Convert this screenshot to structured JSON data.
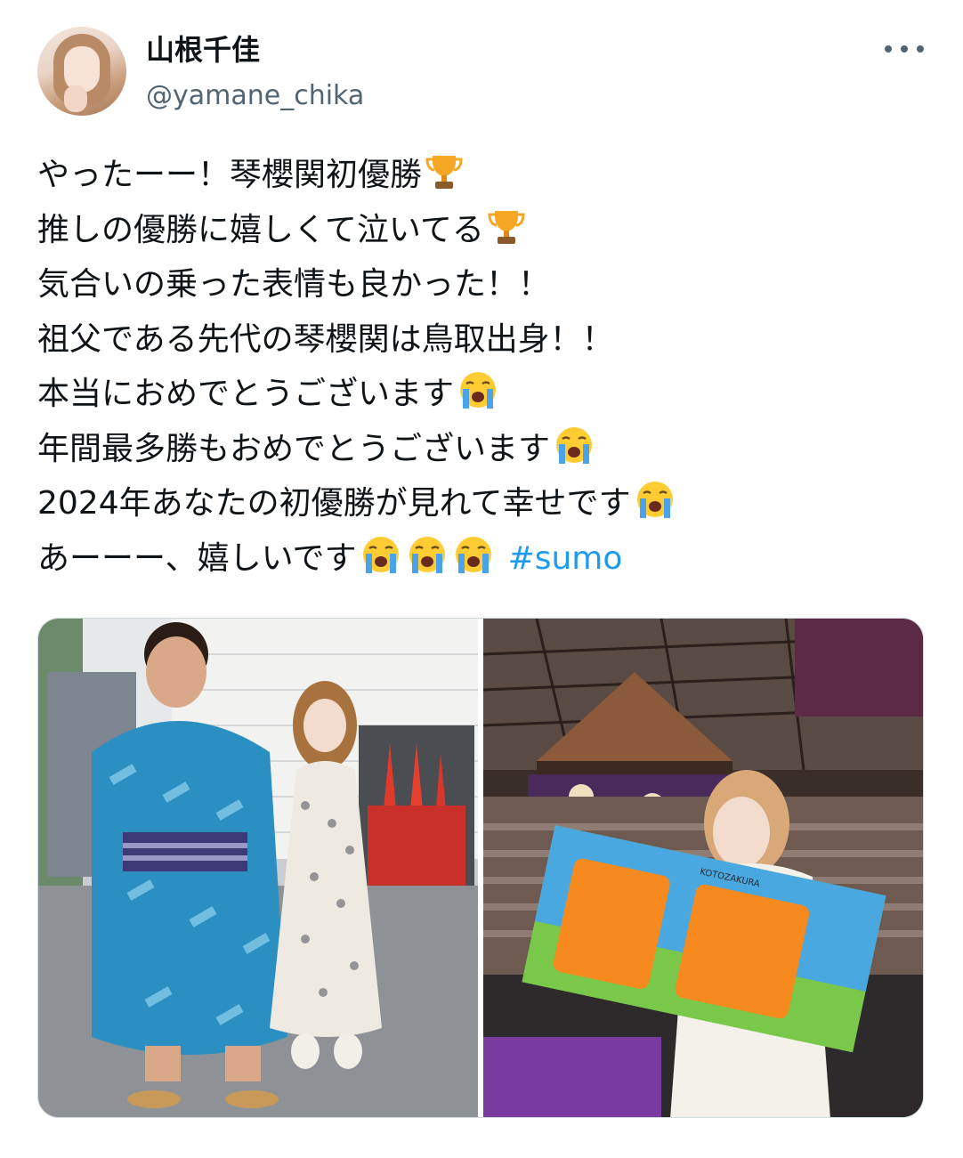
{
  "author": {
    "display_name": "山根千佳",
    "handle": "@yamane_chika"
  },
  "tweet": {
    "lines": [
      {
        "text": "やったーー！琴櫻関初優勝",
        "emoji": "trophy-icon"
      },
      {
        "text": "推しの優勝に嬉しくて泣いてる",
        "emoji": "trophy-icon"
      },
      {
        "text": "気合いの乗った表情も良かった！！"
      },
      {
        "text": "祖父である先代の琴櫻関は鳥取出身！！"
      },
      {
        "text": "本当におめでとうございます",
        "emoji": "crying-face-icon"
      },
      {
        "text": "年間最多勝もおめでとうございます",
        "emoji": "crying-face-icon"
      },
      {
        "text": "2024年あなたの初優勝が見れて幸せです",
        "emoji": "crying-face-icon"
      },
      {
        "text": "あーーー、嬉しいです",
        "emoji_repeat": 3,
        "emoji": "crying-face-icon",
        "hashtag": "#sumo"
      }
    ]
  },
  "media": {
    "photos": [
      {
        "subject": "sumo-wrestler-and-woman-outdoors"
      },
      {
        "subject": "woman-holding-towel-in-arena",
        "towel_text_small": "KOTOZAKURA"
      }
    ]
  },
  "colors": {
    "accent": "#1d9bf0",
    "text": "#0f1419",
    "secondary": "#536471",
    "border": "#cfd9de"
  }
}
